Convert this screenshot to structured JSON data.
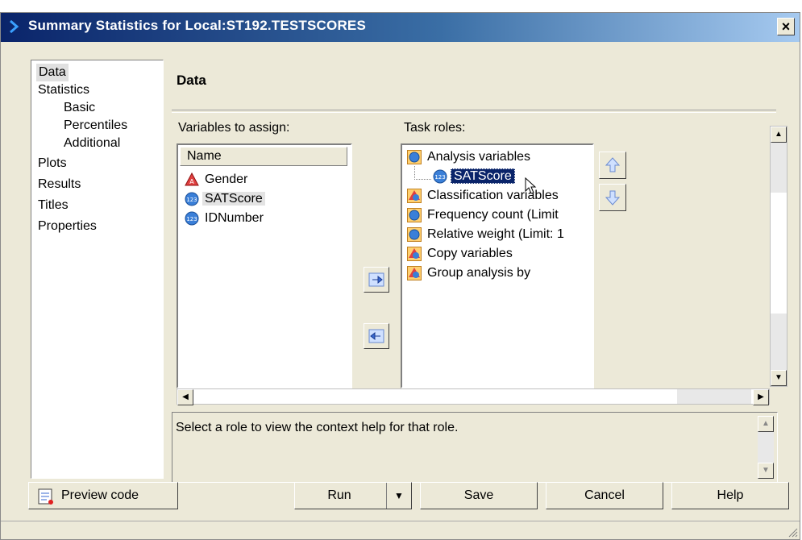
{
  "window": {
    "title": "Summary Statistics for Local:ST192.TESTSCORES",
    "close": "×"
  },
  "nav": {
    "items": [
      {
        "label": "Data",
        "level": 0,
        "selected": true
      },
      {
        "label": "Statistics",
        "level": 0
      },
      {
        "label": "Basic",
        "level": 1
      },
      {
        "label": "Percentiles",
        "level": 1
      },
      {
        "label": "Additional",
        "level": 1
      },
      {
        "label": "Plots",
        "level": 0
      },
      {
        "label": "Results",
        "level": 0
      },
      {
        "label": "Titles",
        "level": 0
      },
      {
        "label": "Properties",
        "level": 0
      }
    ]
  },
  "section": {
    "title": "Data"
  },
  "variables": {
    "label": "Variables to assign:",
    "column_header": "Name",
    "items": [
      {
        "name": "Gender",
        "icon": "character-variable-icon"
      },
      {
        "name": "SATScore",
        "icon": "numeric-variable-icon"
      },
      {
        "name": "IDNumber",
        "icon": "numeric-variable-icon"
      }
    ]
  },
  "roles": {
    "label": "Task roles:",
    "items": [
      {
        "label": "Analysis variables"
      },
      {
        "label": "SATScore"
      },
      {
        "label": "Classification variables"
      },
      {
        "label": "Frequency count  (Limit"
      },
      {
        "label": "Relative weight  (Limit: 1"
      },
      {
        "label": "Copy variables"
      },
      {
        "label": "Group analysis by"
      }
    ]
  },
  "help": {
    "text": "Select a role to view the context help for that role."
  },
  "buttons": {
    "preview": "Preview code",
    "run": "Run",
    "save": "Save",
    "cancel": "Cancel",
    "help": "Help"
  },
  "colors": {
    "titlebar": "#0a246a",
    "selection": "#0a246a",
    "face": "#ece9d8"
  }
}
